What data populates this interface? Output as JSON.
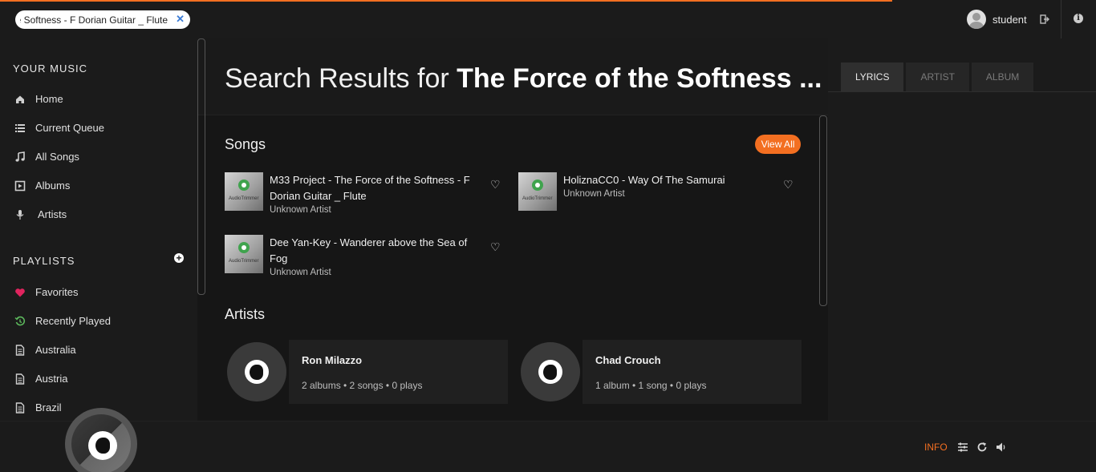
{
  "topbar": {
    "search_value": "The Force of the Softness - F Dorian Guitar _ Flute",
    "clear_icon": "close-icon",
    "username": "student"
  },
  "sidebar": {
    "your_music_title": "YOUR MUSIC",
    "items": [
      {
        "label": "Home",
        "icon": "home-icon"
      },
      {
        "label": "Current Queue",
        "icon": "list-icon"
      },
      {
        "label": "All Songs",
        "icon": "music-note-icon"
      },
      {
        "label": "Albums",
        "icon": "album-icon"
      },
      {
        "label": "Artists",
        "icon": "microphone-icon"
      }
    ],
    "playlists_title": "PLAYLISTS",
    "playlists": [
      {
        "label": "Favorites",
        "icon": "heart-icon"
      },
      {
        "label": "Recently Played",
        "icon": "history-icon"
      },
      {
        "label": "Australia",
        "icon": "document-icon"
      },
      {
        "label": "Austria",
        "icon": "document-icon"
      },
      {
        "label": "Brazil",
        "icon": "document-icon"
      }
    ]
  },
  "main": {
    "title_prefix": "Search Results for ",
    "title_query": "The Force of the Softness ...",
    "songs_title": "Songs",
    "view_all": "View All",
    "cover_text": "AudioTrimmer",
    "songs": [
      {
        "title": "M33 Project - The Force of the Softness - F Dorian Guitar _ Flute",
        "artist": "Unknown Artist"
      },
      {
        "title": "HoliznaCC0 - Way Of The Samurai",
        "artist": "Unknown Artist"
      },
      {
        "title": "Dee Yan-Key - Wanderer above the Sea of Fog",
        "artist": "Unknown Artist"
      }
    ],
    "artists_title": "Artists",
    "artists": [
      {
        "name": "Ron Milazzo",
        "meta": "2 albums • 2 songs • 0 plays"
      },
      {
        "name": "Chad Crouch",
        "meta": "1 album • 1 song • 0 plays"
      }
    ]
  },
  "right_panel": {
    "tabs": [
      "LYRICS",
      "ARTIST",
      "ALBUM"
    ],
    "active_tab": "LYRICS"
  },
  "footer": {
    "info_label": "INFO"
  },
  "colors": {
    "accent": "#f36f21",
    "background": "#1b1b1b",
    "favorite": "#e0245e",
    "recent": "#5cb85c"
  }
}
